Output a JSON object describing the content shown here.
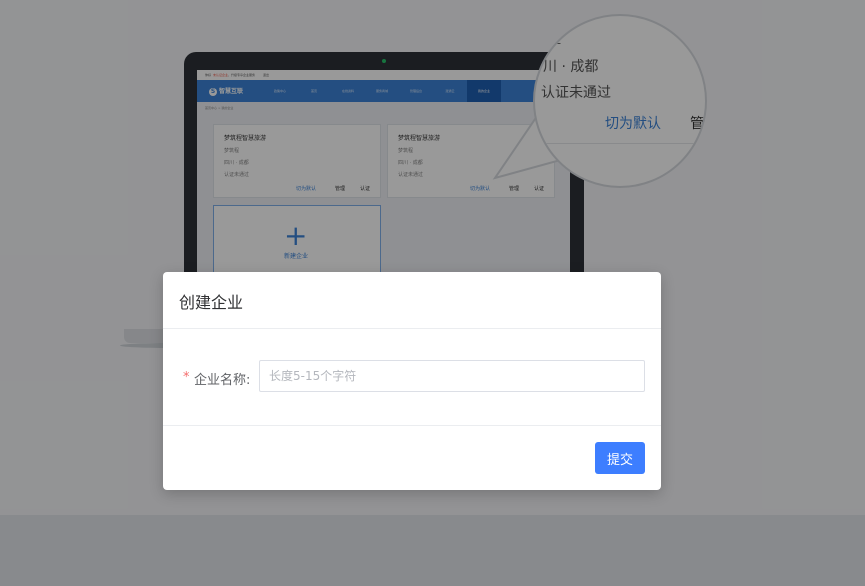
{
  "background": {
    "topbar": {
      "greeting": "你好",
      "warning": "未认证企业",
      "note": "，升级专享企业服务",
      "link": "退出"
    },
    "logo": "智慧互联",
    "nav_items": [
      "政策中心",
      "首页",
      "在线资料",
      "服务商城",
      "管理后台",
      "建通云"
    ],
    "nav_active": "我的企业",
    "breadcrumb": "首页中心 > 我的企业",
    "cards": [
      {
        "title": "梦筑程智慧旅游",
        "person": "梦筑程",
        "region": "四川 · 成都",
        "status": "认证未通过",
        "actions": [
          "切为默认",
          "管理",
          "认证"
        ]
      },
      {
        "title": "梦筑程智慧旅游",
        "person": "梦筑程",
        "region": "四川 · 成都",
        "status": "认证未通过",
        "actions": [
          "切为默认",
          "管理",
          "认证"
        ]
      }
    ],
    "add_card_label": "新建企业",
    "magnifier": {
      "line1": "程",
      "line2": "川 · 成都",
      "line3": "认证未通过",
      "action_default": "切为默认",
      "action_manage": "管"
    }
  },
  "modal": {
    "title": "创建企业",
    "required_mark": "*",
    "field_label": "企业名称:",
    "field_value": "",
    "field_placeholder": "长度5-15个字符",
    "submit_label": "提交"
  },
  "colors": {
    "primary": "#3d7eff",
    "required": "#f56c6c",
    "mask": "rgba(0,0,0,0.4)"
  }
}
